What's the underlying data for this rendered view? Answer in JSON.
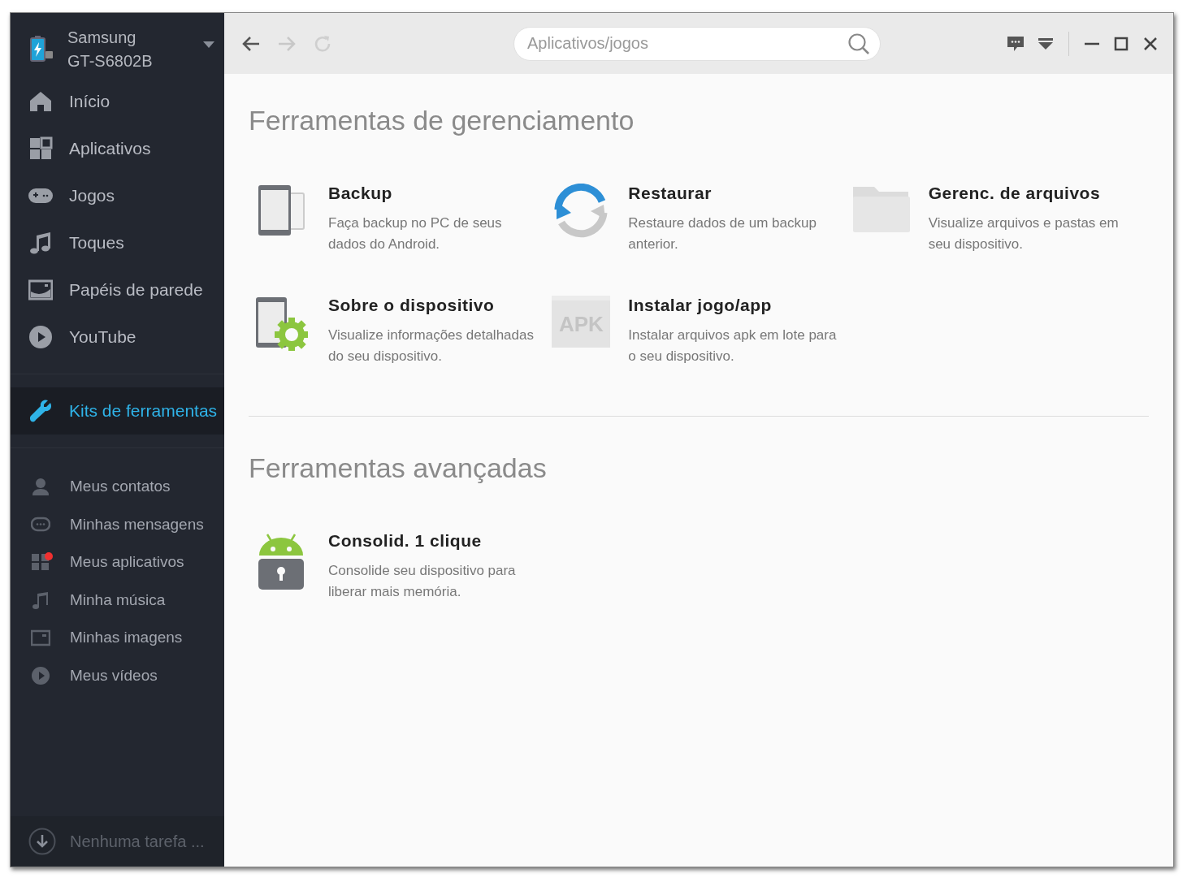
{
  "device": {
    "brand": "Samsung",
    "model": "GT-S6802B"
  },
  "nav": [
    {
      "label": "Início",
      "selected": false
    },
    {
      "label": "Aplicativos",
      "selected": false
    },
    {
      "label": "Jogos",
      "selected": false
    },
    {
      "label": "Toques",
      "selected": false
    },
    {
      "label": "Papéis de parede",
      "selected": false
    },
    {
      "label": "YouTube",
      "selected": false
    }
  ],
  "toolkit": {
    "label": "Kits de ferramentas",
    "selected": true
  },
  "my_items": [
    {
      "label": "Meus contatos",
      "badge": false
    },
    {
      "label": "Minhas mensagens",
      "badge": false
    },
    {
      "label": "Meus aplicativos",
      "badge": true
    },
    {
      "label": "Minha música",
      "badge": false
    },
    {
      "label": "Minhas imagens",
      "badge": false
    },
    {
      "label": "Meus vídeos",
      "badge": false
    }
  ],
  "task_status": "Nenhuma tarefa ...",
  "toolbar": {
    "back_disabled": false,
    "forward_disabled": true,
    "refresh_disabled": true,
    "search": {
      "placeholder": "Aplicativos/jogos"
    }
  },
  "sections": [
    {
      "title": "Ferramentas de gerenciamento",
      "tools": [
        {
          "title": "Backup",
          "description": "Faça backup no PC de seus dados do Android."
        },
        {
          "title": "Restaurar",
          "description": "Restaure dados de um backup anterior."
        },
        {
          "title": "Gerenc. de arquivos",
          "description": "Visualize arquivos e pastas em seu dispositivo."
        },
        {
          "title": "Sobre o dispositivo",
          "description": "Visualize informações detalhadas do seu dispositivo."
        },
        {
          "title": "Instalar jogo/app",
          "description": "Instalar arquivos apk em lote para o seu dispositivo.",
          "icon_text": "APK"
        }
      ]
    },
    {
      "title": "Ferramentas avançadas",
      "tools": [
        {
          "title": "Consolid. 1 clique",
          "description": "Consolide seu dispositivo para liberar mais memória."
        }
      ]
    }
  ]
}
